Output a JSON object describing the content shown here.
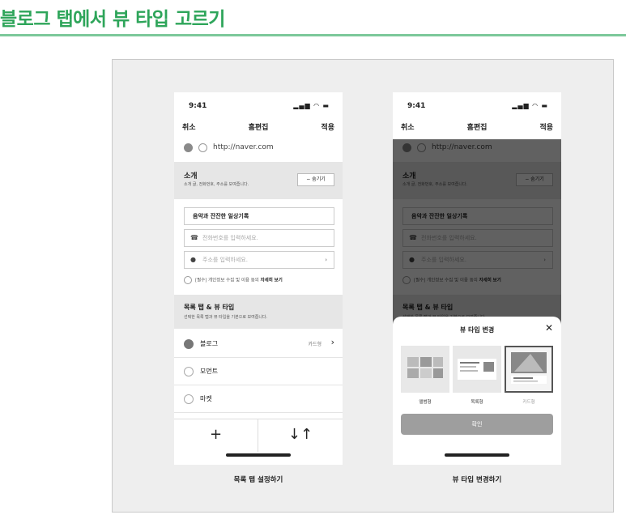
{
  "page": {
    "title": "블로그 탭에서 뷰 타입 고르기",
    "accent": "#2ea55a"
  },
  "status": {
    "time": "9:41",
    "icons": "▂▄▆ ◠ ▬"
  },
  "nav": {
    "cancel": "취소",
    "title": "홈편집",
    "apply": "적용"
  },
  "url": "http://naver.com",
  "intro": {
    "title": "소개",
    "desc": "소개 글, 전화번호, 주소를 보여줍니다.",
    "hide": "− 숨기기"
  },
  "form": {
    "name": "음악과 잔잔한 일상기록",
    "phone_placeholder": "전화번호를 입력하세요.",
    "address_placeholder": "주소를 입력하세요.",
    "consent_prefix": "[필수] 개인정보 수집 및 이용 동의",
    "consent_link": "자세히 보기"
  },
  "list_section": {
    "title": "목록 탭 & 뷰 타입",
    "desc": "선택한 목록 탭과 뷰 타입을 기본으로 보여줍니다."
  },
  "list_items": [
    {
      "label": "블로그",
      "sub": "카드형",
      "selected": true
    },
    {
      "label": "모먼트",
      "sub": "",
      "selected": false
    },
    {
      "label": "마켓",
      "sub": "",
      "selected": false
    }
  ],
  "bottom": {
    "add": "+",
    "sort": "↓↑"
  },
  "sheet": {
    "title": "뷰 타입 변경",
    "close": "✕",
    "options": [
      "앨범형",
      "목록형",
      "카드형"
    ],
    "confirm": "확인"
  },
  "captions": [
    "목록 탭 설정하기",
    "뷰 타입 변경하기"
  ]
}
